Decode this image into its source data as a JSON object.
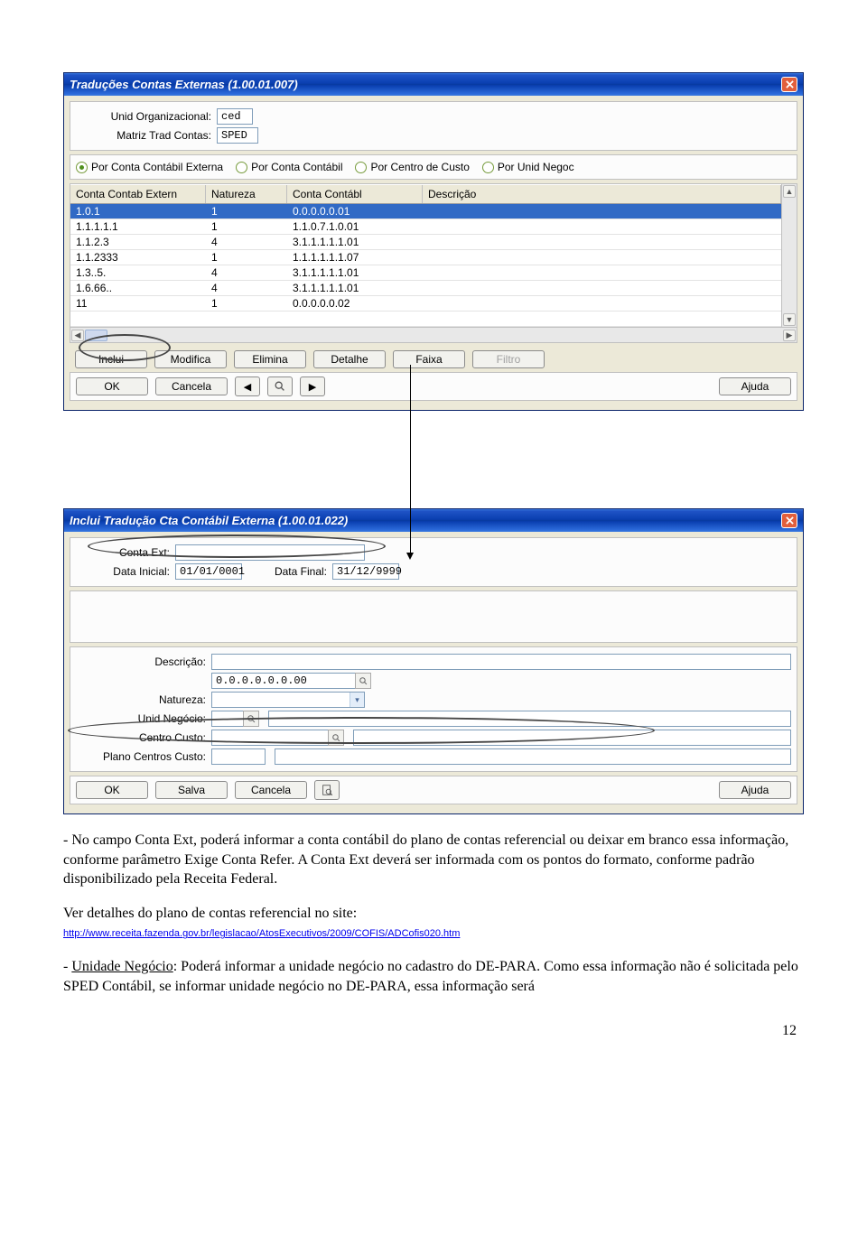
{
  "win1": {
    "title": "Traduções Contas Externas (1.00.01.007)",
    "fields": {
      "unid_org_label": "Unid Organizacional:",
      "unid_org_value": "ced",
      "matriz_label": "Matriz Trad Contas:",
      "matriz_value": "SPED"
    },
    "radios": {
      "r1": "Por Conta Contábil Externa",
      "r2": "Por Conta Contábil",
      "r3": "Por Centro de Custo",
      "r4": "Por Unid Negoc"
    },
    "headers": {
      "c1": "Conta Contab Extern",
      "c2": "Natureza",
      "c3": "Conta Contábl",
      "c4": "Descrição"
    },
    "rows": [
      {
        "c1": "1.0.1",
        "c2": "1",
        "c3": "0.0.0.0.0.01",
        "c4": ""
      },
      {
        "c1": "1.1.1.1.1",
        "c2": "1",
        "c3": "1.1.0.7.1.0.01",
        "c4": ""
      },
      {
        "c1": "1.1.2.3",
        "c2": "4",
        "c3": "3.1.1.1.1.1.01",
        "c4": ""
      },
      {
        "c1": "1.1.2333",
        "c2": "1",
        "c3": "1.1.1.1.1.1.07",
        "c4": ""
      },
      {
        "c1": "1.3..5.",
        "c2": "4",
        "c3": "3.1.1.1.1.1.01",
        "c4": ""
      },
      {
        "c1": "1.6.66..",
        "c2": "4",
        "c3": "3.1.1.1.1.1.01",
        "c4": ""
      },
      {
        "c1": "11",
        "c2": "1",
        "c3": "0.0.0.0.0.02",
        "c4": ""
      }
    ],
    "buttons": {
      "inclui": "Inclui",
      "modifica": "Modifica",
      "elimina": "Elimina",
      "detalhe": "Detalhe",
      "faixa": "Faixa",
      "filtro": "Filtro"
    },
    "bottom": {
      "ok": "OK",
      "cancela": "Cancela",
      "ajuda": "Ajuda"
    }
  },
  "win2": {
    "title": "Inclui Tradução Cta Contábil Externa (1.00.01.022)",
    "labels": {
      "conta_ext": "Conta Ext:",
      "data_inicial": "Data Inicial:",
      "data_inicial_v": "01/01/0001",
      "data_final": "Data Final:",
      "data_final_v": "31/12/9999",
      "descricao": "Descrição:",
      "code": "0.0.0.0.0.0.00",
      "natureza": "Natureza:",
      "unid_neg": "Unid Negócio:",
      "centro": "Centro Custo:",
      "plano": "Plano Centros Custo:"
    },
    "buttons": {
      "ok": "OK",
      "salva": "Salva",
      "cancela": "Cancela",
      "ajuda": "Ajuda"
    }
  },
  "text": {
    "p1": "- No campo Conta Ext, poderá informar a conta contábil do plano de contas referencial ou deixar em branco essa informação, conforme parâmetro Exige Conta Refer. A Conta Ext deverá ser informada com os pontos do formato, conforme padrão disponibilizado pela Receita Federal.",
    "p2a": "Ver detalhes do plano de contas referencial no site:",
    "link": "http://www.receita.fazenda.gov.br/legislacao/AtosExecutivos/2009/COFIS/ADCofis020.htm",
    "p3_lead": "- ",
    "p3_u": "Unidade Negócio",
    "p3_rest": ": Poderá informar a unidade negócio no cadastro do DE-PARA. Como essa informação não é solicitada pelo SPED Contábil, se informar unidade negócio no DE-PARA, essa informação será"
  },
  "pagenum": "12"
}
